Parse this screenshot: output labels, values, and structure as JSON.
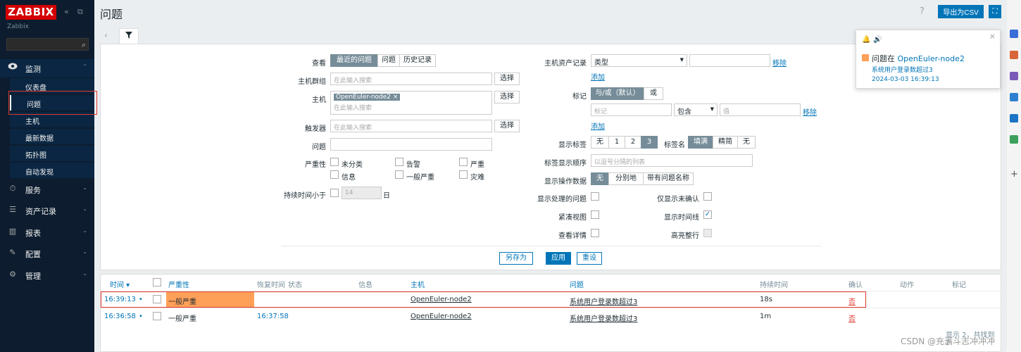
{
  "sidebar": {
    "logo": "ZABBIX",
    "subtitle": "Zabbix",
    "collapse_icon": "«",
    "kiosk_icon": "⧉",
    "search_icon": "search-icon",
    "sections": [
      {
        "label": "监测",
        "icon": "eye-icon",
        "chev": "⌃"
      },
      {
        "label": "服务",
        "icon": "clock-icon",
        "chev": "⌄"
      },
      {
        "label": "资产记录",
        "icon": "list-icon",
        "chev": "⌄"
      },
      {
        "label": "报表",
        "icon": "chart-icon",
        "chev": "⌄"
      },
      {
        "label": "配置",
        "icon": "wrench-icon",
        "chev": "⌄"
      },
      {
        "label": "管理",
        "icon": "gear-icon",
        "chev": "⌄"
      }
    ],
    "monitoring_items": [
      {
        "label": "仪表盘"
      },
      {
        "label": "问题"
      },
      {
        "label": "主机"
      },
      {
        "label": "最新数据"
      },
      {
        "label": "拓扑图"
      },
      {
        "label": "自动发现"
      }
    ]
  },
  "header": {
    "title": "问题",
    "help": "?",
    "export_csv": "导出为CSV",
    "fullscreen_icon": "fullscreen-icon"
  },
  "filter_tab": {
    "back": "‹",
    "icon": "filter-icon"
  },
  "filter": {
    "show": {
      "label": "查看",
      "options": [
        "最近的问题",
        "问题",
        "历史记录"
      ],
      "selected": "最近的问题"
    },
    "host_groups": {
      "label": "主机群组",
      "placeholder": "在此输入搜索",
      "select": "选择"
    },
    "hosts": {
      "label": "主机",
      "chip": "OpenEuler-node2",
      "chip_remove": "×",
      "placeholder": "在此输入搜索",
      "select": "选择"
    },
    "triggers": {
      "label": "触发器",
      "placeholder": "在此输入搜索",
      "select": "选择"
    },
    "problem": {
      "label": "问题",
      "value": ""
    },
    "severity": {
      "label": "严重性",
      "options": [
        "未分类",
        "告警",
        "严重",
        "信息",
        "一般严重",
        "灾难"
      ]
    },
    "age": {
      "label": "持续时间小于",
      "value": "14",
      "unit": "日"
    },
    "inventory": {
      "label": "主机资产记录",
      "field": "类型",
      "value": "",
      "remove": "移除",
      "add": "添加"
    },
    "tags": {
      "label": "标记",
      "ops": [
        "与/或（默认）",
        "或"
      ],
      "tag_placeholder": "标记",
      "operator": "包含",
      "value_placeholder": "值",
      "remove": "移除",
      "add": "添加"
    },
    "show_tags": {
      "label": "显示标签",
      "options": [
        "无",
        "1",
        "2",
        "3"
      ],
      "selected": "3"
    },
    "tag_name": {
      "label": "标签名",
      "options": [
        "填满",
        "精简",
        "无"
      ],
      "selected": "填满"
    },
    "tag_priority": {
      "label": "标签显示顺序",
      "placeholder": "以逗号分隔的列表"
    },
    "show_opdata": {
      "label": "显示操作数据",
      "options": [
        "无",
        "分别地",
        "带有问题名称"
      ],
      "selected": "无"
    },
    "show_suppressed": {
      "label": "显示处理的问题"
    },
    "unack": {
      "label": "仅显示未确认"
    },
    "compact": {
      "label": "紧凑视图"
    },
    "timeline": {
      "label": "显示时间线"
    },
    "details": {
      "label": "查看详情"
    },
    "highlight": {
      "label": "高亮整行"
    },
    "save_as": "另存为",
    "apply": "应用",
    "reset": "重设"
  },
  "table": {
    "headers": {
      "time": "时间 ▾",
      "severity": "严重性",
      "recovery": "恢复时间",
      "status": "状态",
      "info": "信息",
      "host": "主机",
      "problem": "问题",
      "duration": "持续时间",
      "ack": "确认",
      "actions": "动作",
      "tags": "标记"
    },
    "rows": [
      {
        "time": "16:39:13",
        "severity": "一般严重",
        "recovery": "",
        "host": "OpenEuler-node2",
        "problem": "系统用户登录数超过3",
        "duration": "18s",
        "ack": "否"
      },
      {
        "time": "16:36:58",
        "severity": "一般严重",
        "recovery": "16:37:58",
        "host": "OpenEuler-node2",
        "problem": "系统用户登录数超过3",
        "duration": "1m",
        "ack": "否"
      }
    ],
    "footer": "显示 2，共找到 2"
  },
  "notification": {
    "prefix": "问题在 ",
    "host": "OpenEuler-node2",
    "problem": "系统用户登录数超过3",
    "time": "2024-03-03 16:39:13",
    "close": "×",
    "bell": "bell-icon",
    "sound": "sound-icon"
  },
  "watermark": "CSDN @充满斗志冲冲冲",
  "colors": {
    "severity_average": "#ffa059",
    "nav_bg": "#0d1d2f",
    "accent": "#0275b8",
    "red": "#e0382d"
  }
}
